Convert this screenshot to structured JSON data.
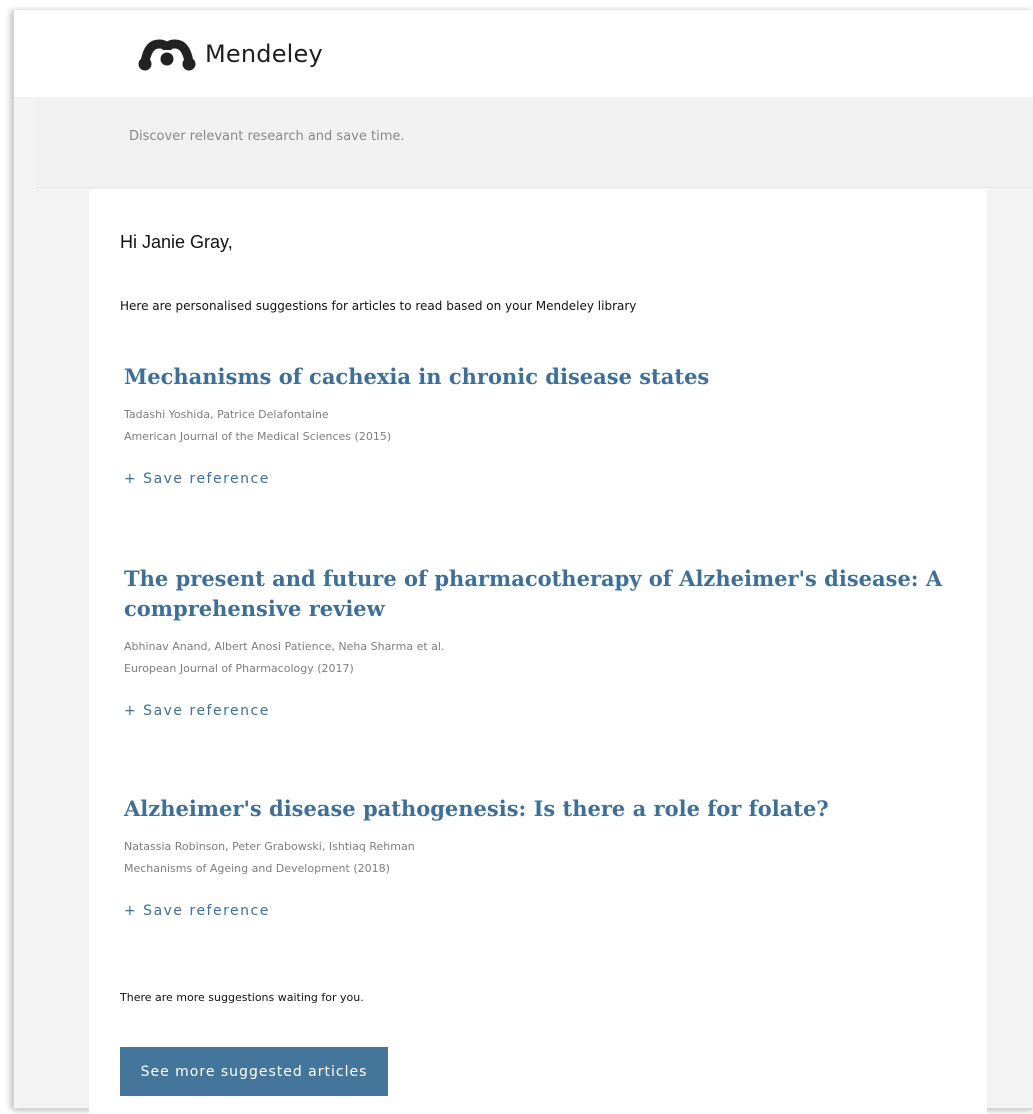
{
  "brand": {
    "name": "Mendeley",
    "logo_icon": "mendeley-logo-icon"
  },
  "header": {
    "tagline": "Discover relevant research and save time."
  },
  "email": {
    "greeting": "Hi Janie Gray,",
    "intro": "Here are personalised suggestions for articles to read based on your Mendeley library",
    "articles": [
      {
        "title": "Mechanisms of cachexia in chronic disease states",
        "authors": "Tadashi Yoshida, Patrice Delafontaine",
        "journal": "American Journal of the Medical Sciences (2015)",
        "save_label": "+ Save reference"
      },
      {
        "title": "The present and future of pharmacotherapy of Alzheimer's disease: A comprehensive review",
        "authors": "Abhinav Anand, Albert Anosi Patience, Neha Sharma et al.",
        "journal": "European Journal of Pharmacology (2017)",
        "save_label": "+ Save reference"
      },
      {
        "title": "Alzheimer's disease pathogenesis: Is there a role for folate?",
        "authors": "Natassia Robinson, Peter Grabowski, Ishtiaq Rehman",
        "journal": "Mechanisms of Ageing and Development (2018)",
        "save_label": "+ Save reference"
      }
    ],
    "more_text": "There are more suggestions waiting for you.",
    "cta_label": "See more suggested articles"
  },
  "colors": {
    "accent": "#3f6f95",
    "button": "#44759a",
    "background": "#f3f3f3"
  }
}
